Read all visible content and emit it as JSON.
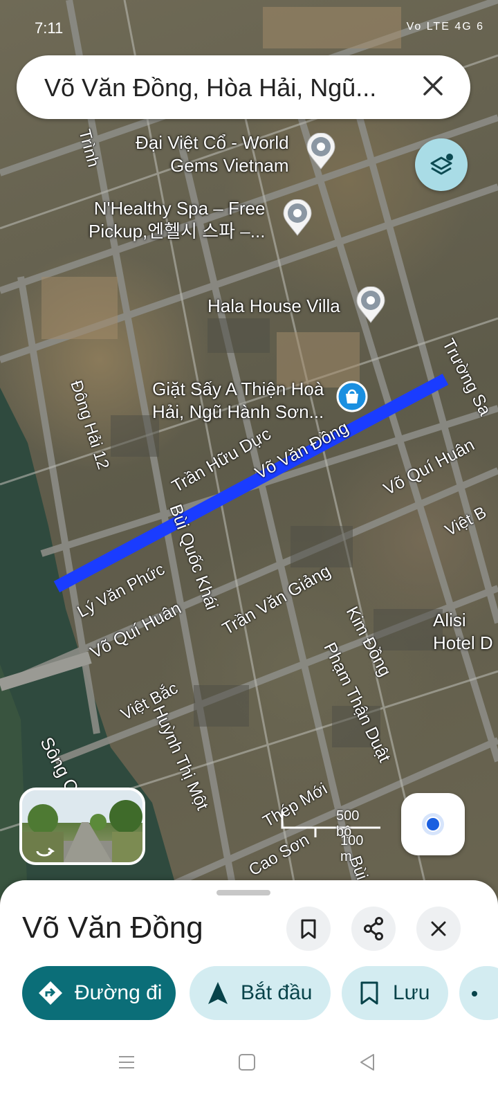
{
  "status_bar": {
    "time": "7:11",
    "right_indicators": "Vo LTE 4G 6"
  },
  "search": {
    "query": "Võ Văn Đồng, Hòa Hải, Ngũ..."
  },
  "map": {
    "pois": [
      {
        "name_line1": "Đại Việt Cổ - World",
        "name_line2": "Gems Vietnam"
      },
      {
        "name_line1": "N'Healthy Spa – Free",
        "name_line2": "Pickup,엔헬시 스파 –..."
      },
      {
        "name_line1": "Hala House Villa",
        "name_line2": ""
      },
      {
        "name_line1": "Giặt Sấy A Thiện Hoà",
        "name_line2": "Hải, Ngũ Hành Sơn..."
      }
    ],
    "streets": {
      "truong_sa": "Trường Sa",
      "vo_van_dong": "Võ Văn Đồng",
      "tran_huu_duc": "Trần Hữu Dực",
      "vo_qui_huan_top": "Võ Quí Huân",
      "dong_hai_12": "Đông Hải 12",
      "bui_quoc_khai": "Bùi Quốc Khái",
      "ly_van_phuc": "Lý Văn Phức",
      "vo_qui_huan_bottom": "Võ Quí Huân",
      "tran_van_giang": "Trần Văn Giảng",
      "kim_dong": "Kim Đồng",
      "pham_than_duat": "Phạm Thận Duật",
      "viet_bac": "Việt Bắc",
      "huynh_thi_mot": "Huỳnh Thị Một",
      "thep_moi": "Thép Mới",
      "cao_son": "Cao Sơn",
      "song": "Sông C",
      "viet_b_right": "Việt B",
      "truong_sa_top": "Trình",
      "bui_bottom": "Bùi"
    },
    "alisia": {
      "line1": "Alisi",
      "line2": "Hotel D"
    },
    "scale": {
      "imperial": "500 bộ",
      "metric": "100 m"
    },
    "route_color": "#1a3cff"
  },
  "sheet": {
    "title": "Võ Văn Đồng",
    "actions": {
      "directions": "Đường đi",
      "start": "Bắt đầu",
      "save": "Lưu"
    },
    "accent": "#0b6e78"
  }
}
